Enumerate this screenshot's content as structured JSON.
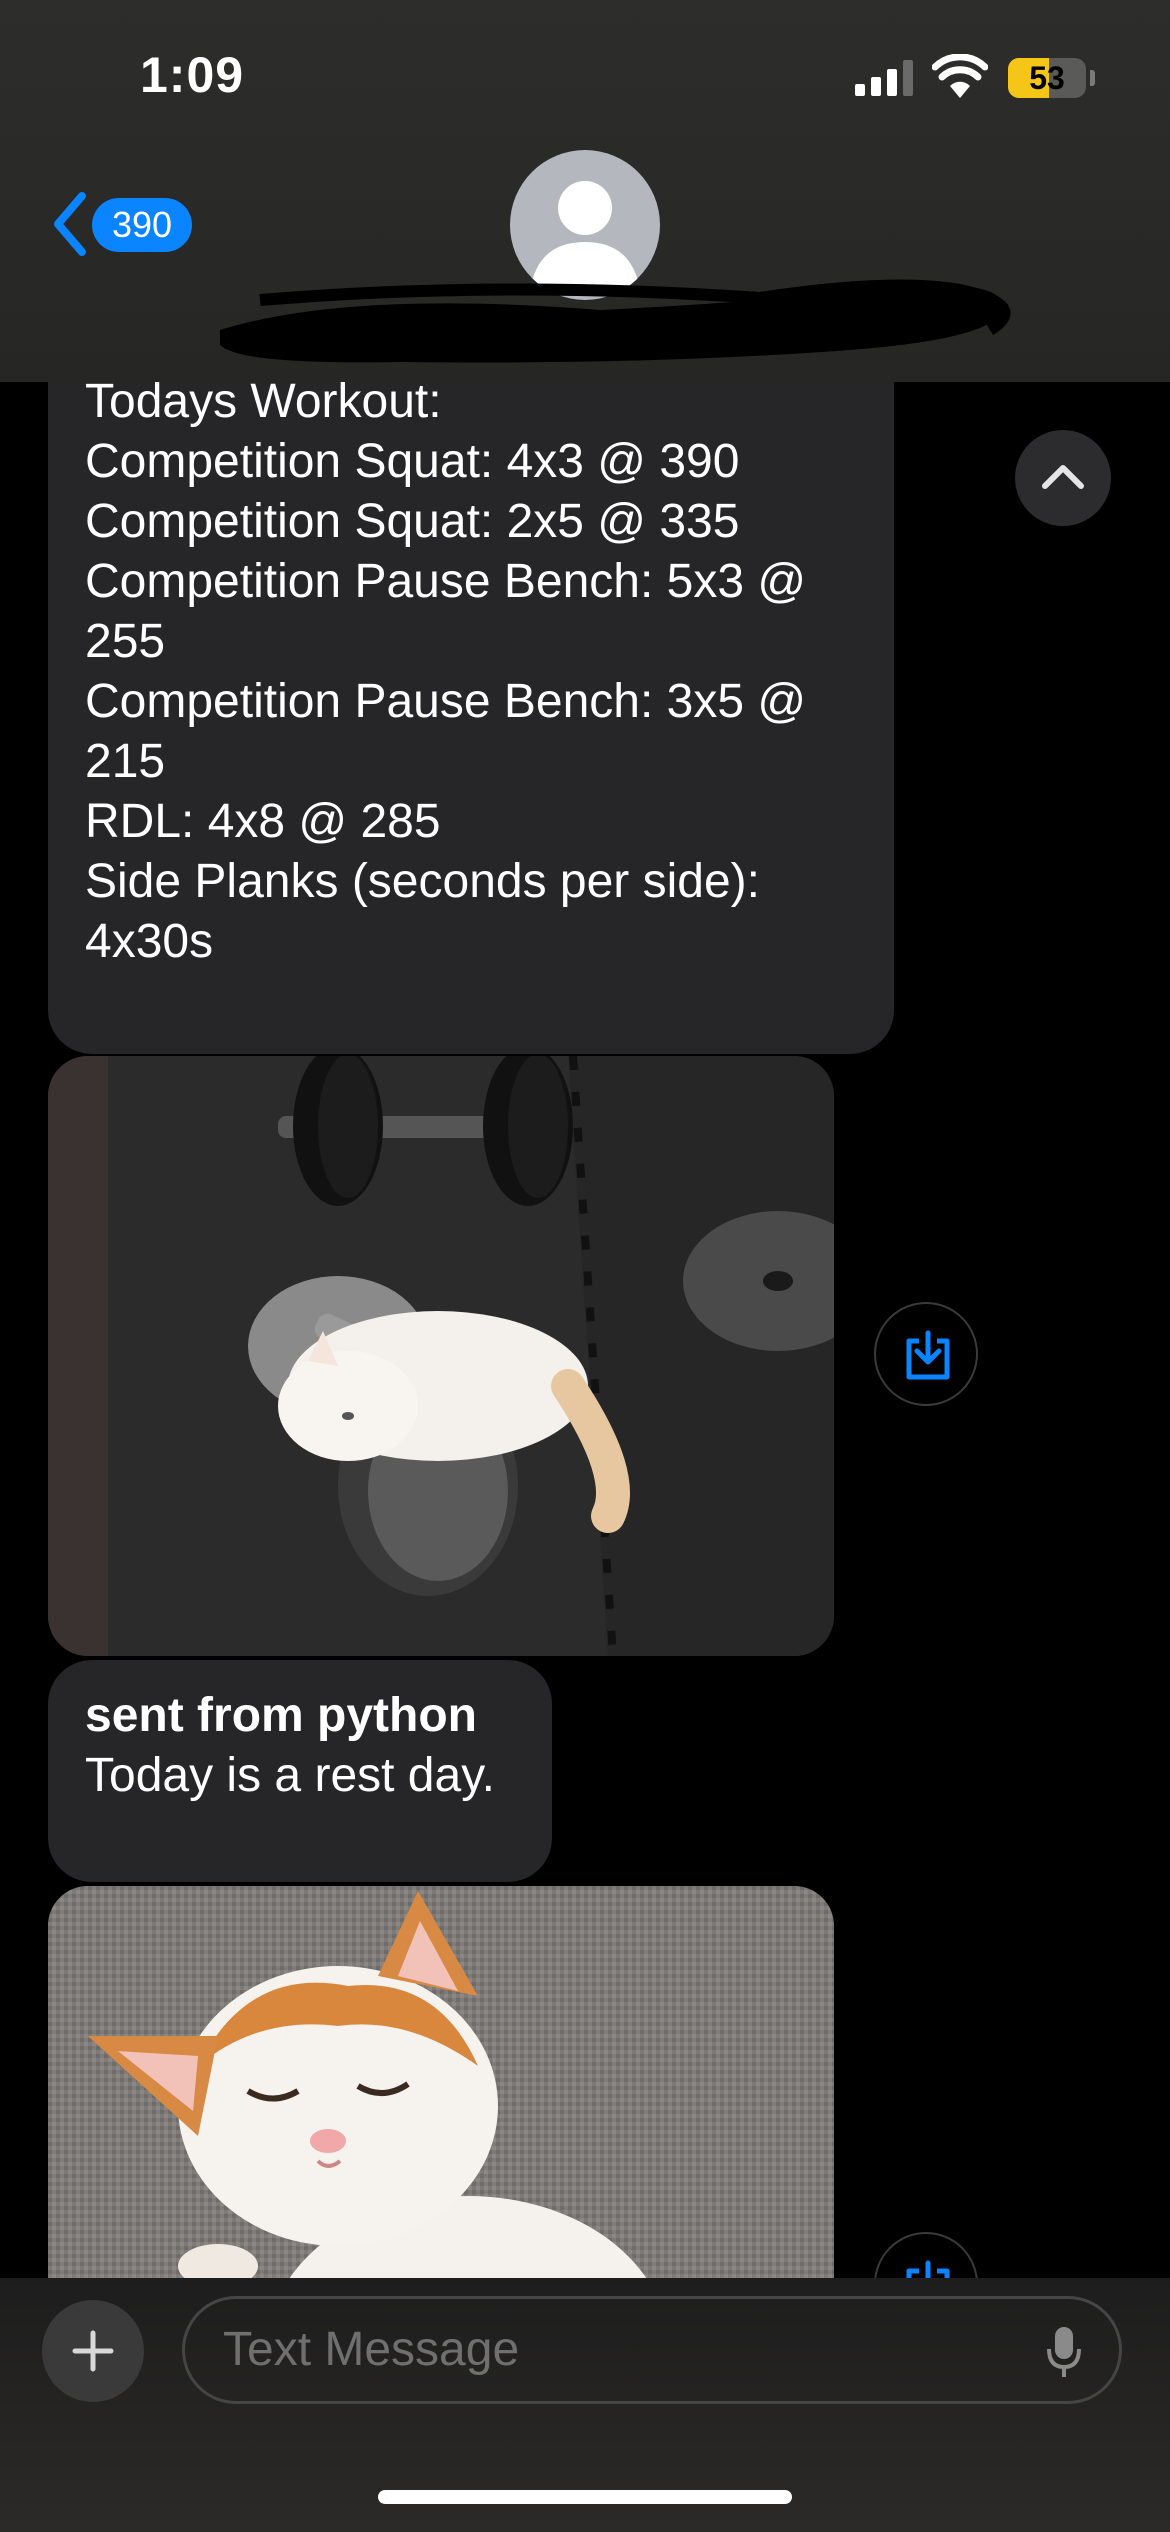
{
  "status_bar": {
    "time": "1:09",
    "battery_percent": "53",
    "battery_level": 0.53,
    "battery_color": "#f5c518",
    "signal_icon": "cellular-signal-icon",
    "wifi_icon": "wifi-icon"
  },
  "header": {
    "back_badge": "390",
    "back_icon": "chevron-left-icon",
    "avatar_icon": "person-silhouette-icon",
    "contact_name_redacted": true,
    "accent_color": "#0a84ff"
  },
  "messages": {
    "workout_lines": [
      "Todays Workout:",
      "Competition Squat: 4x3 @ 390",
      "Competition Squat: 2x5 @ 335",
      "Competition Pause Bench: 5x3 @",
      "255",
      "Competition Pause Bench: 3x5 @",
      "215",
      "RDL: 4x8 @ 285",
      "Side Planks (seconds per side):",
      "4x30s"
    ],
    "scroll_up_icon": "chevron-up-icon",
    "photo_1_subject": "kitten sleeping on dumbbell",
    "save_icon": "save-to-photos-icon",
    "python_title": "sent from python",
    "python_body": "Today is a rest day.",
    "photo_2_subject": "orange and white kitten sleeping"
  },
  "composer": {
    "placeholder": "Text Message",
    "plus_icon": "plus-icon",
    "mic_icon": "microphone-icon"
  }
}
